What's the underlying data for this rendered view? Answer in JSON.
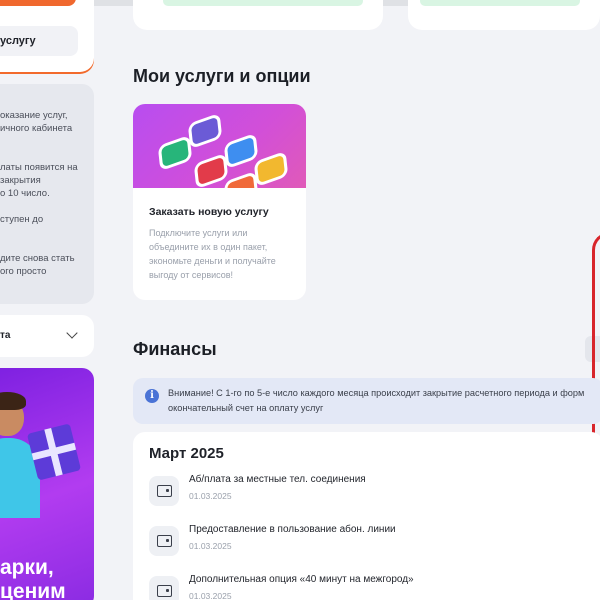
{
  "left_panel": {
    "service_button_label": "услугу",
    "info_lines": [
      "оказание услуг,",
      "ичного кабинета",
      "латы появится на",
      "закрытия",
      "о 10 число.",
      "ступен до",
      "дите снова стать",
      "ого просто"
    ],
    "select_label": "та",
    "promo_lines": [
      "арки,",
      "ценим"
    ]
  },
  "services": {
    "heading": "Мои услуги и опции",
    "card": {
      "title": "Заказать новую услугу",
      "description": "Подключите услуги или объедините их в один пакет, экономьте деньги и получайте выгоду от сервисов!"
    }
  },
  "finance": {
    "heading": "Финансы",
    "notice_lines": [
      "Внимание! С 1-го по 5-е число каждого месяца происходит закрытие расчетного периода и форм",
      "окончательный счет на оплату услуг"
    ],
    "month": "Март 2025",
    "charges": [
      {
        "name": "Аб/плата за местные тел. соединения",
        "date": "01.03.2025"
      },
      {
        "name": "Предоставление в пользование абон. линии",
        "date": "01.03.2025"
      },
      {
        "name": "Дополнительная опция «40 минут на межгород»",
        "date": "01.03.2025"
      }
    ]
  },
  "colors": {
    "accent_orange": "#f0682e",
    "promo_purple": "#7b1fe0",
    "notice_blue": "#4a73d6",
    "highlight_red": "#d8252b"
  }
}
